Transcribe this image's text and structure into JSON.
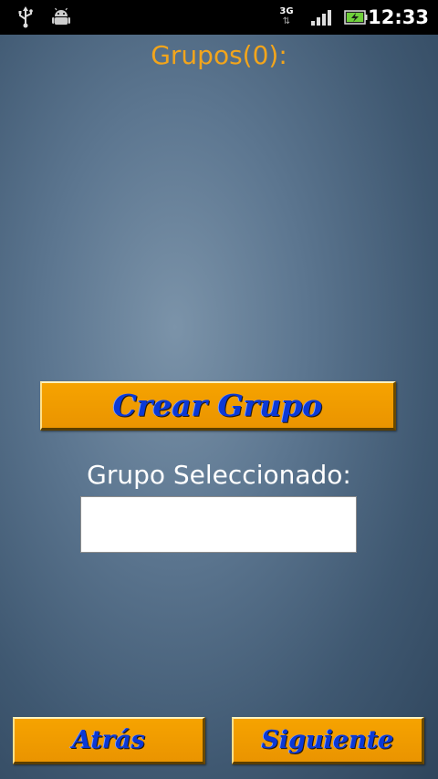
{
  "status_bar": {
    "network_type": "3G",
    "network_arrows": "⇅",
    "time": "12:33",
    "icons": [
      "usb-icon",
      "android-debug-icon",
      "network-3g-icon",
      "signal-bars-icon",
      "battery-charging-icon"
    ]
  },
  "groups": {
    "title": "Grupos(0):"
  },
  "create_group": {
    "label": "Crear Grupo"
  },
  "selected_group": {
    "label": "Grupo Seleccionado:",
    "value": ""
  },
  "navigation": {
    "back_label": "Atrás",
    "next_label": "Siguiente"
  },
  "colors": {
    "title_accent": "#f2a51c",
    "button_fill": "#f09a00",
    "button_text": "#0b39d6",
    "background": "#5c7690"
  }
}
